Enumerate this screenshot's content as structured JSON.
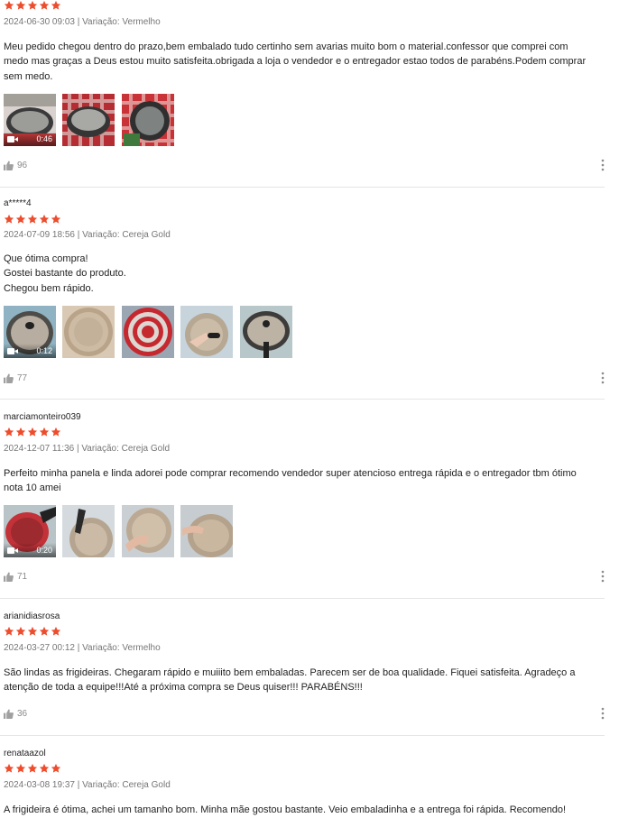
{
  "colors": {
    "star": "#ee4d2d",
    "meta": "#767676",
    "divider": "#e5e5e5"
  },
  "icons": {
    "star": "star-icon",
    "like": "thumbs-up-icon",
    "more": "more-vertical-icon",
    "video": "video-camera-icon"
  },
  "reviews": [
    {
      "user": "",
      "rating": 5,
      "meta": "2024-06-30 09:03 | Variação: Vermelho",
      "lines": [
        "Meu pedido chegou dentro do prazo,bem embalado tudo certinho sem avarias muito bom o material.confessor que comprei com medo mas graças a Deus estou muito satisfeita.obrigada a loja o vendedor e o entregador estao todos de parabéns.Podem comprar sem medo."
      ],
      "media": [
        {
          "type": "video",
          "duration": "0:46"
        },
        {
          "type": "image"
        },
        {
          "type": "image"
        }
      ],
      "likes": "96"
    },
    {
      "user": "a*****4",
      "rating": 5,
      "meta": "2024-07-09 18:56 | Variação: Cereja Gold",
      "lines": [
        "Que ótima compra!",
        "Gostei bastante do produto.",
        "Chegou bem rápido."
      ],
      "media": [
        {
          "type": "video",
          "duration": "0:12"
        },
        {
          "type": "image"
        },
        {
          "type": "image"
        },
        {
          "type": "image"
        },
        {
          "type": "image"
        }
      ],
      "likes": "77"
    },
    {
      "user": "marciamonteiro039",
      "rating": 5,
      "meta": "2024-12-07 11:36 | Variação: Cereja Gold",
      "lines": [
        "Perfeito minha panela e linda adorei pode comprar recomendo vendedor super atencioso entrega rápida e o entregador tbm ótimo nota 10 amei"
      ],
      "media": [
        {
          "type": "video",
          "duration": "0:20"
        },
        {
          "type": "image"
        },
        {
          "type": "image"
        },
        {
          "type": "image"
        }
      ],
      "likes": "71"
    },
    {
      "user": "arianidiasrosa",
      "rating": 5,
      "meta": "2024-03-27 00:12 | Variação: Vermelho",
      "lines": [
        "São lindas as frigideiras. Chegaram rápido e muiiito bem embaladas. Parecem ser de boa qualidade. Fiquei satisfeita. Agradeço a atenção de toda a equipe!!!Até a próxima compra se Deus quiser!!! PARABÉNS!!!"
      ],
      "media": [],
      "likes": "36"
    },
    {
      "user": "renataazol",
      "rating": 5,
      "meta": "2024-03-08 19:37 | Variação: Cereja Gold",
      "lines": [
        "A frigideira é ótima, achei um tamanho bom. Minha mãe gostou bastante. Veio embaladinha e a entrega foi rápida. Recomendo!"
      ],
      "media": [],
      "likes": ""
    }
  ]
}
